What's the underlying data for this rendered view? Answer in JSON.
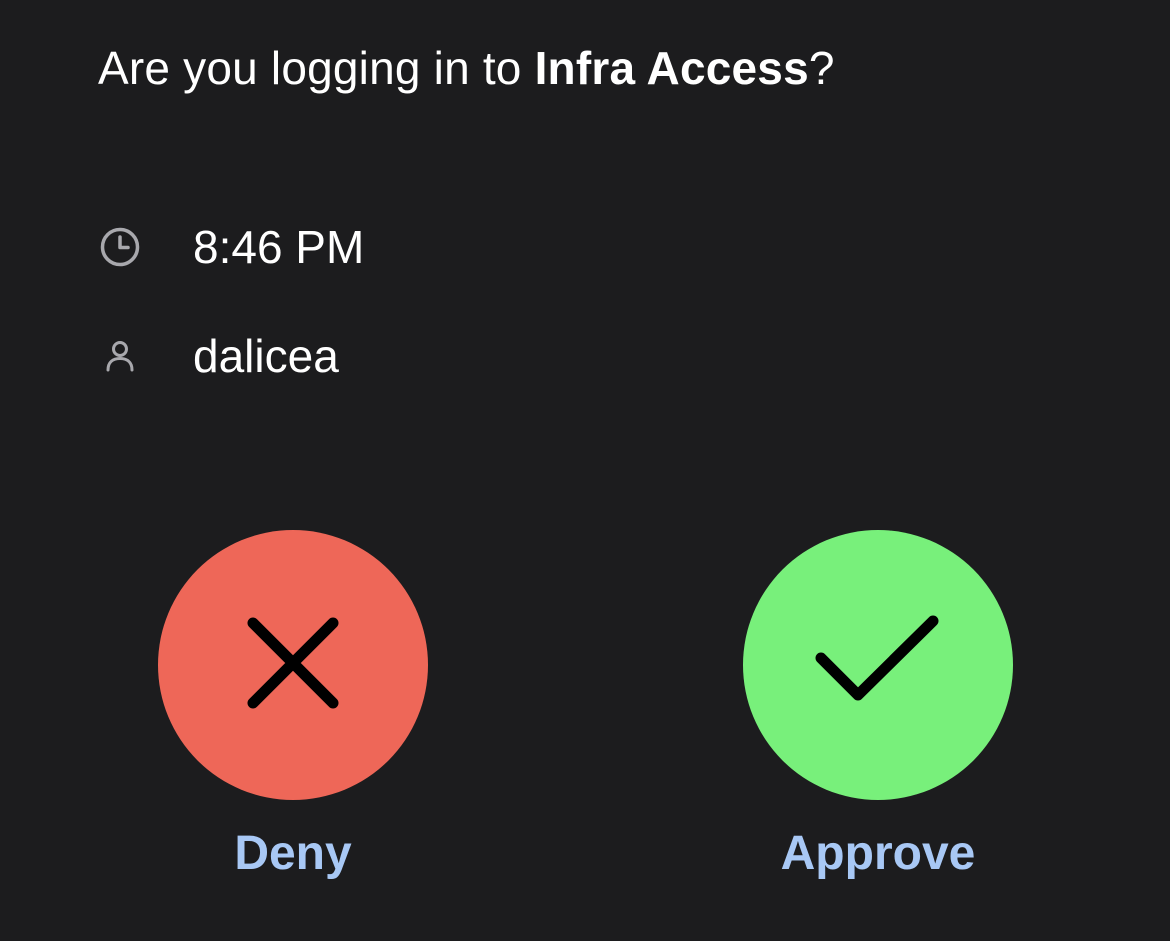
{
  "prompt": {
    "prefix": "Are you logging in to ",
    "app_name": "Infra Access",
    "suffix": "?"
  },
  "details": {
    "time": {
      "icon": "clock-icon",
      "value": "8:46 PM"
    },
    "user": {
      "icon": "person-icon",
      "value": "dalicea"
    }
  },
  "actions": {
    "deny": {
      "label": "Deny",
      "icon": "x-icon",
      "color": "#ee6758"
    },
    "approve": {
      "label": "Approve",
      "icon": "checkmark-icon",
      "color": "#78f07b"
    }
  },
  "colors": {
    "background": "#1c1c1e",
    "text": "#ffffff",
    "icon_gray": "#a8a8ad",
    "action_label": "#a8c8f5"
  }
}
